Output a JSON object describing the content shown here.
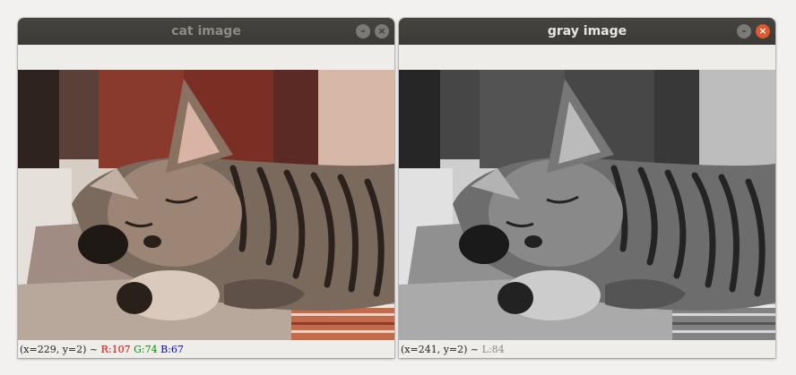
{
  "windows": [
    {
      "title": "cat image",
      "status": {
        "coords": "(x=229, y=2) ~",
        "r": "R:107",
        "g": "G:74",
        "b": "B:67"
      }
    },
    {
      "title": "gray image",
      "status": {
        "coords": "(x=241, y=2) ~",
        "l": "L:84"
      }
    }
  ],
  "buttons": {
    "minimize_glyph": "–",
    "close_glyph": "×"
  },
  "colors": {
    "red": "#e00000",
    "green": "#009000",
    "blue": "#0000d0",
    "gray": "#888888"
  }
}
